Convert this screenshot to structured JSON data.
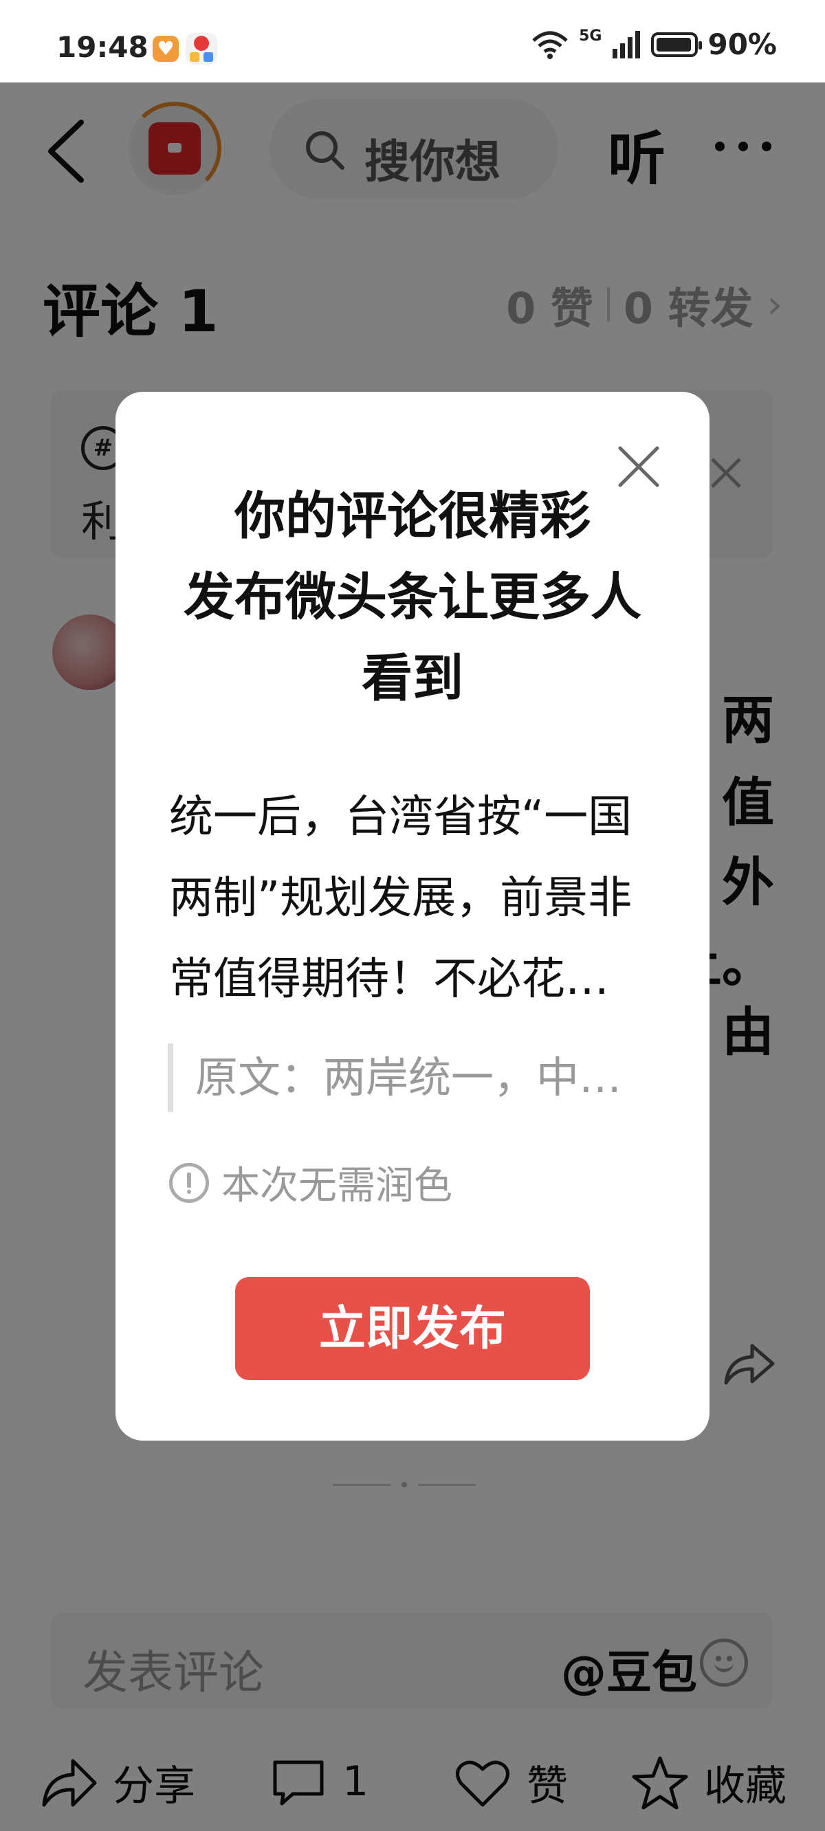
{
  "status_bar": {
    "time": "19:48",
    "network": "5G",
    "battery": "90%"
  },
  "header": {
    "search_placeholder": "搜你想",
    "listen_label": "听"
  },
  "comments": {
    "title": "评论 1",
    "likes": "0 赞",
    "reposts": "0 转发",
    "topic_text": "利",
    "body_fragments": [
      "两",
      "值",
      "外",
      "上。",
      "由"
    ]
  },
  "comment_input": {
    "placeholder": "发表评论",
    "mention": "@豆包"
  },
  "bottom_bar": {
    "share": "分享",
    "comment_count": "1",
    "like": "赞",
    "favorite": "收藏"
  },
  "modal": {
    "title_lines": [
      "你的评论很精彩",
      "发布微头条让更多人",
      "看到"
    ],
    "text_lines": [
      "统一后，台湾省按“一国",
      "两制”规划发展，前景非",
      "常值得期待！不必花…"
    ],
    "quote": "原文：两岸统一，中…",
    "note": "本次无需润色",
    "button": "立即发布"
  },
  "colors": {
    "accent": "#e8514a",
    "overlay": "rgba(0,0,0,0.5)",
    "muted": "#999999"
  }
}
